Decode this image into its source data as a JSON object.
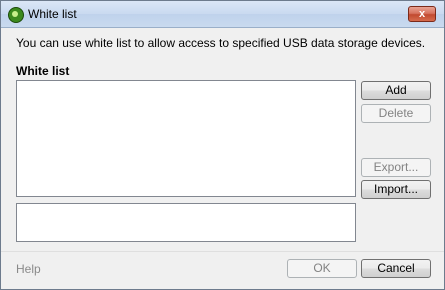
{
  "window": {
    "title": "White list",
    "close_label": "x"
  },
  "main": {
    "description": "You can use white list to allow access to specified USB data storage devices.",
    "section_label": "White list"
  },
  "buttons": {
    "add": "Add",
    "delete": "Delete",
    "export": "Export...",
    "import": "Import..."
  },
  "footer": {
    "help": "Help",
    "ok": "OK",
    "cancel": "Cancel"
  },
  "icons": {
    "app": "kaspersky-shield-icon",
    "close": "close-icon"
  }
}
